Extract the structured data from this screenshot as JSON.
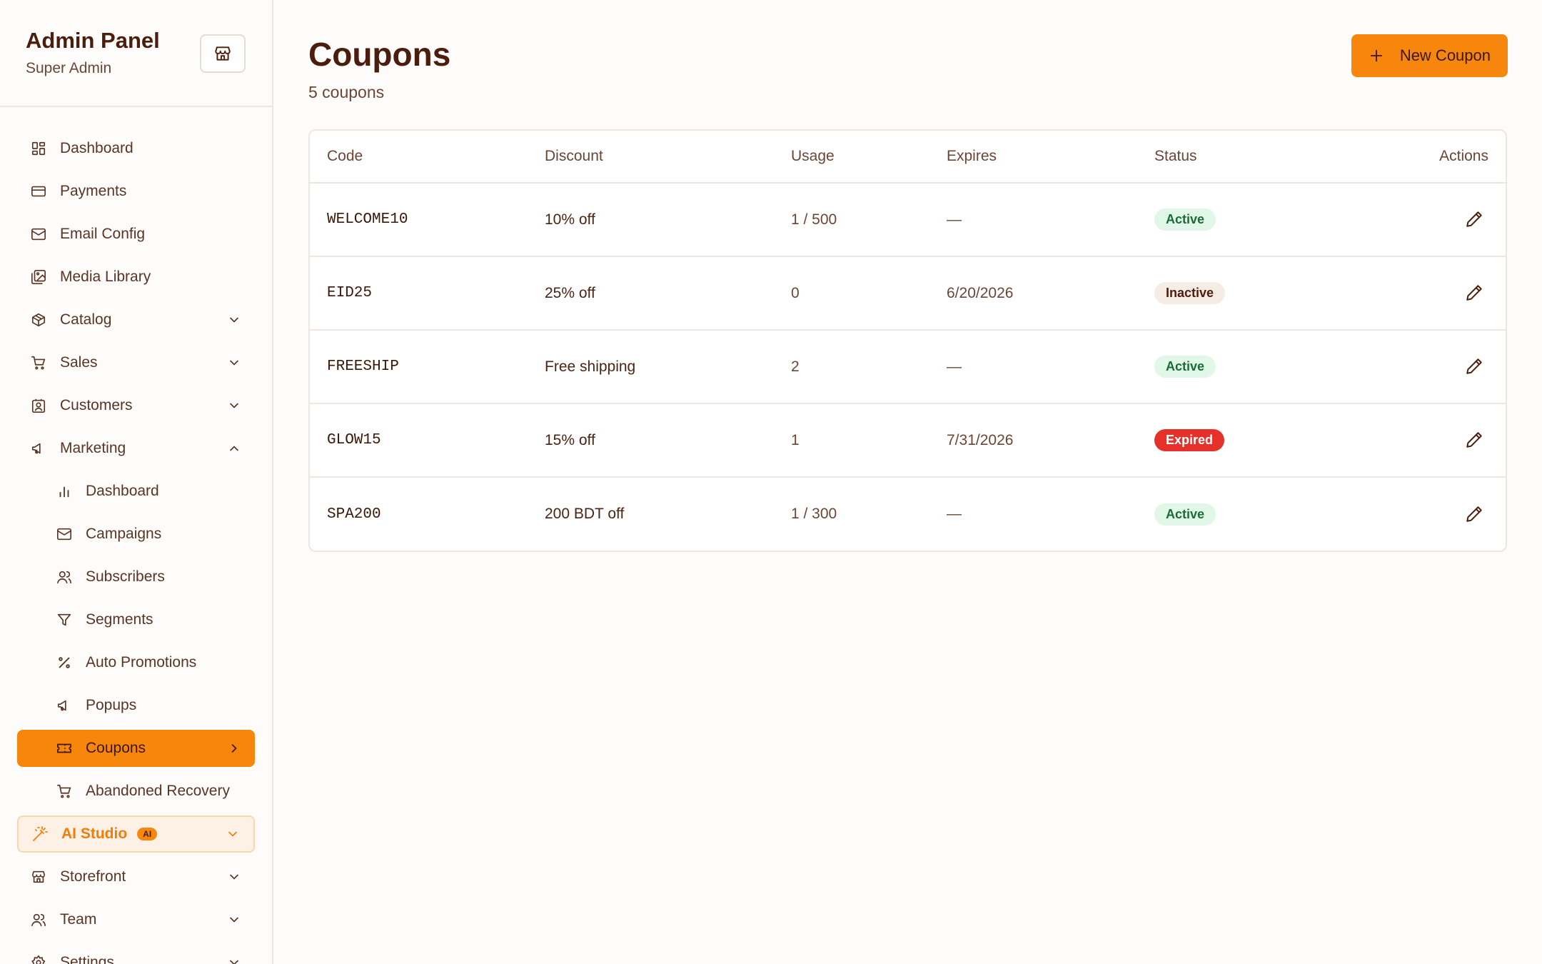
{
  "sidebar": {
    "title": "Admin Panel",
    "subtitle": "Super Admin",
    "items": [
      {
        "label": "Dashboard",
        "icon": "grid-icon"
      },
      {
        "label": "Payments",
        "icon": "credit-card-icon"
      },
      {
        "label": "Email Config",
        "icon": "mail-icon"
      },
      {
        "label": "Media Library",
        "icon": "images-icon"
      },
      {
        "label": "Catalog",
        "icon": "package-icon"
      },
      {
        "label": "Sales",
        "icon": "cart-icon"
      },
      {
        "label": "Customers",
        "icon": "contact-icon"
      },
      {
        "label": "Marketing",
        "icon": "megaphone-icon"
      },
      {
        "label": "Dashboard",
        "icon": "bar-chart-icon"
      },
      {
        "label": "Campaigns",
        "icon": "mail-icon"
      },
      {
        "label": "Subscribers",
        "icon": "users-icon"
      },
      {
        "label": "Segments",
        "icon": "filter-icon"
      },
      {
        "label": "Auto Promotions",
        "icon": "percent-icon"
      },
      {
        "label": "Popups",
        "icon": "megaphone-icon"
      },
      {
        "label": "Coupons",
        "icon": "ticket-icon"
      },
      {
        "label": "Abandoned Recovery",
        "icon": "cart-icon"
      },
      {
        "label": "AI Studio",
        "icon": "wand-icon",
        "badge": "AI"
      },
      {
        "label": "Storefront",
        "icon": "store-icon"
      },
      {
        "label": "Team",
        "icon": "users-icon"
      },
      {
        "label": "Settings",
        "icon": "gear-icon"
      }
    ]
  },
  "page": {
    "title": "Coupons",
    "count": "5 coupons",
    "new_button": "New Coupon"
  },
  "table": {
    "columns": [
      "Code",
      "Discount",
      "Usage",
      "Expires",
      "Status",
      "Actions"
    ],
    "rows": [
      {
        "code": "WELCOME10",
        "discount": "10% off",
        "usage": "1 / 500",
        "expires": "—",
        "status": "Active"
      },
      {
        "code": "EID25",
        "discount": "25% off",
        "usage": "0",
        "expires": "6/20/2026",
        "status": "Inactive"
      },
      {
        "code": "FREESHIP",
        "discount": "Free shipping",
        "usage": "2",
        "expires": "—",
        "status": "Active"
      },
      {
        "code": "GLOW15",
        "discount": "15% off",
        "usage": "1",
        "expires": "7/31/2026",
        "status": "Expired"
      },
      {
        "code": "SPA200",
        "discount": "200 BDT off",
        "usage": "1 / 300",
        "expires": "—",
        "status": "Active"
      }
    ]
  },
  "colors": {
    "accent": "#f7860c",
    "text": "#4a1d0c",
    "active_badge": "#e1f7e7",
    "expired_badge": "#e5312a"
  }
}
